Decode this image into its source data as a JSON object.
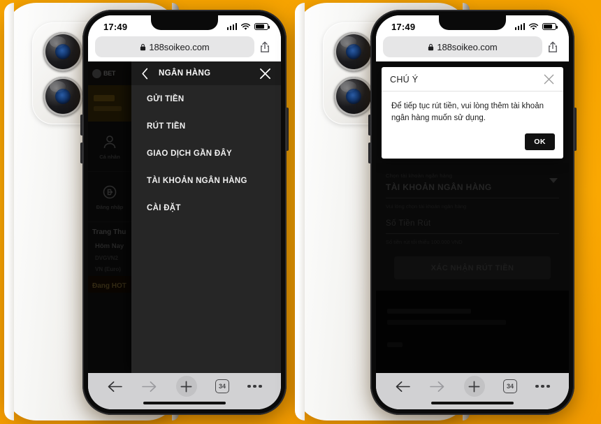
{
  "background": {
    "color": "#FBA903"
  },
  "devices": [
    {
      "id": "left",
      "back_phone": {
        "color": "#f2f0ec",
        "camera": "dual-camera-module"
      },
      "status_bar": {
        "time": "17:49",
        "signal_icon": "cellular-signal-icon",
        "wifi_icon": "wifi-icon",
        "battery_icon": "battery-icon"
      },
      "browser": {
        "url": "188soikeo.com",
        "lock_icon": "lock-icon",
        "share_icon": "share-icon",
        "toolbar": {
          "back_icon": "arrow-left-icon",
          "forward_icon": "arrow-right-icon",
          "new_tab_icon": "plus-icon",
          "tab_count": "34",
          "more_icon": "ellipsis-icon"
        }
      },
      "side_menu": {
        "back_icon": "chevron-left-icon",
        "title": "NGÂN HÀNG",
        "close_icon": "close-icon",
        "items": [
          {
            "label": "GỬI TIỀN"
          },
          {
            "label": "RÚT TIỀN"
          },
          {
            "label": "GIAO DỊCH GẦN ĐÂY"
          },
          {
            "label": "TÀI KHOẢN NGÂN HÀNG"
          },
          {
            "label": "CÀI ĐẶT"
          }
        ]
      },
      "background_rail": {
        "logo_text": "BET",
        "cells": [
          {
            "icon": "user-icon",
            "label": "Cá nhân"
          },
          {
            "icon": "login-icon",
            "label": "Đăng nhập"
          }
        ],
        "section_title": "Trang Thu",
        "rows": [
          {
            "label": "Hôm Nay"
          },
          {
            "label": "DVGVN2"
          },
          {
            "label": "VN (Euro)"
          }
        ],
        "hot_title": "Đang HOT"
      }
    },
    {
      "id": "right",
      "back_phone": {
        "color": "#f2f0ec",
        "camera": "dual-camera-module"
      },
      "status_bar": {
        "time": "17:49",
        "signal_icon": "cellular-signal-icon",
        "wifi_icon": "wifi-icon",
        "battery_icon": "battery-icon"
      },
      "browser": {
        "url": "188soikeo.com",
        "lock_icon": "lock-icon",
        "share_icon": "share-icon",
        "toolbar": {
          "back_icon": "arrow-left-icon",
          "forward_icon": "arrow-right-icon",
          "new_tab_icon": "plus-icon",
          "tab_count": "34",
          "more_icon": "ellipsis-icon"
        }
      },
      "dialog": {
        "title": "CHÚ Ý",
        "close_icon": "close-icon",
        "message": "Để tiếp tục rút tiền, vui lòng thêm tài khoản ngân hàng muốn sử dụng.",
        "ok_label": "OK"
      },
      "withdraw_form": {
        "account_hint": "Chọn tài khoản ngân hàng",
        "account_value": "TÀI KHOẢN NGÂN HÀNG",
        "dropdown_icon": "caret-down-icon",
        "account_note": "Vui lòng chọn tài khoản ngân hàng",
        "amount_placeholder": "Số Tiền Rút",
        "amount_note": "Số tiền rút tối thiểu 100.000 VND",
        "submit_label": "XÁC NHẬN RÚT TIỀN"
      }
    }
  ]
}
